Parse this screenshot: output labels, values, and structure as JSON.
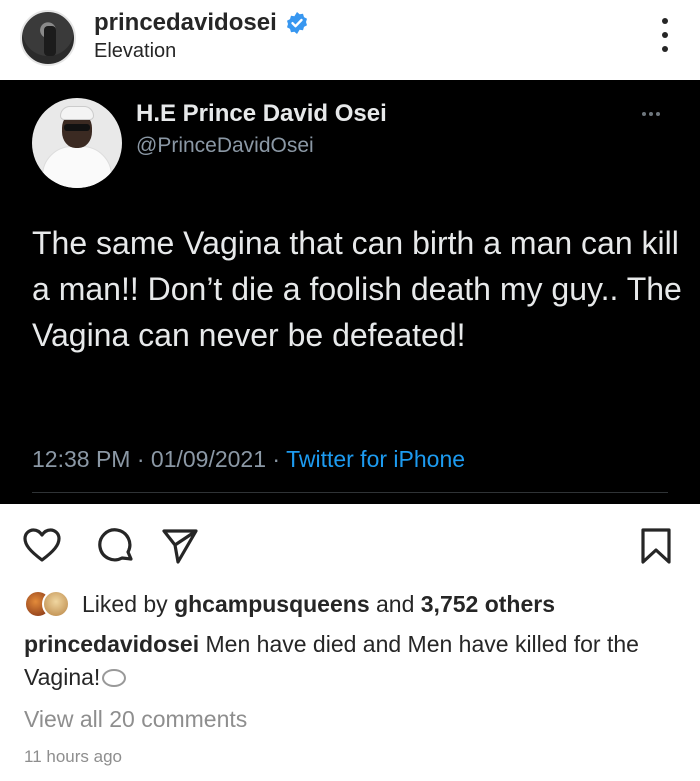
{
  "header": {
    "username": "princedavidosei",
    "location": "Elevation",
    "verified_color": "#3897f0"
  },
  "tweet": {
    "display_name": "H.E Prince David Osei",
    "handle": "@PrinceDavidOsei",
    "text": "The same Vagina that can birth a man can kill a man!! Don’t die a foolish death my guy.. The Vagina can never be defeated!",
    "time": "12:38 PM",
    "separator": " · ",
    "date": "01/09/2021",
    "source": "Twitter for iPhone",
    "background": "#000000",
    "link_color": "#1d9bf0"
  },
  "actions": {
    "icons": [
      "heart-icon",
      "comment-icon",
      "share-icon",
      "bookmark-icon"
    ]
  },
  "likes": {
    "prefix": "Liked by ",
    "first_user": "ghcampusqueens",
    "middle": " and ",
    "others": "3,752 others"
  },
  "caption": {
    "username": "princedavidosei",
    "text": " Men have died and Men have killed for the Vagina!"
  },
  "comments": {
    "view_all": "View all 20 comments"
  },
  "timestamp": "11 hours ago"
}
